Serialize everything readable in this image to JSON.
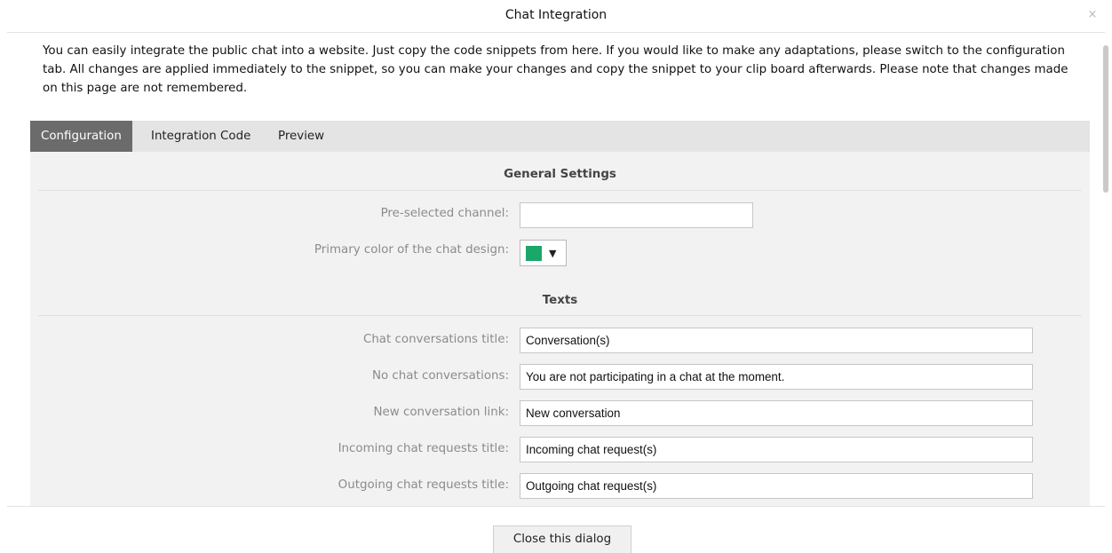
{
  "dialog": {
    "title": "Chat Integration",
    "close_glyph": "×",
    "intro": "You can easily integrate the public chat into a website. Just copy the code snippets from here. If you would like to make any adaptations, please switch to the configuration tab. All changes are applied immediately to the snippet, so you can make your changes and copy the snippet to your clip board afterwards. Please note that changes made on this page are not remembered."
  },
  "tabs": [
    {
      "label": "Configuration",
      "active": true
    },
    {
      "label": "Integration Code",
      "active": false
    },
    {
      "label": "Preview",
      "active": false
    }
  ],
  "general_settings": {
    "heading": "General Settings",
    "preselected_channel_label": "Pre-selected channel:",
    "preselected_channel_value": "",
    "primary_color_label": "Primary color of the chat design:",
    "primary_color": "#1aa86a",
    "color_caret": "▼"
  },
  "texts": {
    "heading": "Texts",
    "fields": [
      {
        "label": "Chat conversations title:",
        "value": "Conversation(s)"
      },
      {
        "label": "No chat conversations:",
        "value": "You are not participating in a chat at the moment."
      },
      {
        "label": "New conversation link:",
        "value": "New conversation"
      },
      {
        "label": "Incoming chat requests title:",
        "value": "Incoming chat request(s)"
      },
      {
        "label": "Outgoing chat requests title:",
        "value": "Outgoing chat request(s)"
      }
    ]
  },
  "footer": {
    "close_button_label": "Close this dialog"
  },
  "colors": {
    "active_tab_bg": "#6b6b6b",
    "tab_bar_bg": "#e4e4e4",
    "panel_bg": "#f2f2f2"
  },
  "icons": {
    "close": "close-icon",
    "dropdown": "chevron-down-icon"
  }
}
